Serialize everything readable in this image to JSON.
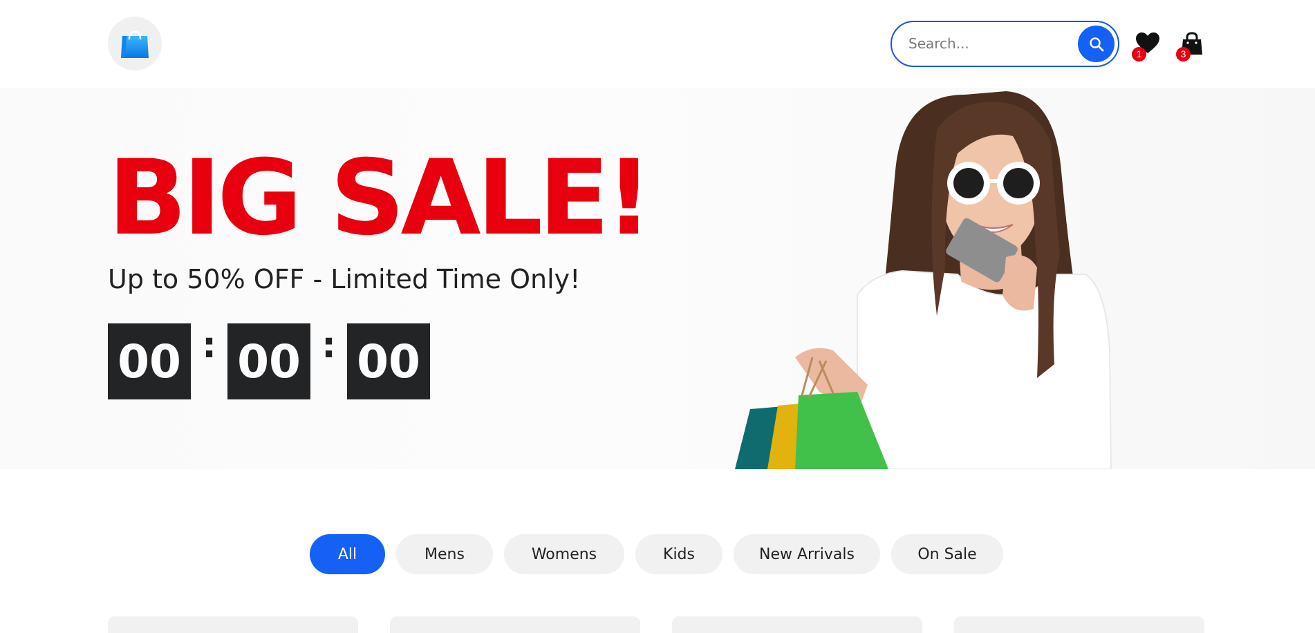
{
  "header": {
    "logo_icon": "shopping-bag-icon",
    "search": {
      "placeholder": "Search...",
      "icon": "search-icon"
    },
    "wishlist": {
      "icon": "heart-icon",
      "count": "1"
    },
    "cart": {
      "icon": "bag-icon",
      "count": "3"
    }
  },
  "hero": {
    "title": "BIG SALE!",
    "subtitle": "Up to 50% OFF - Limited Time Only!",
    "countdown": {
      "hours": "00",
      "minutes": "00",
      "seconds": "00",
      "separator": ":"
    },
    "accent_color": "#e8000f"
  },
  "categories": {
    "items": [
      {
        "label": "All",
        "active": true
      },
      {
        "label": "Mens",
        "active": false
      },
      {
        "label": "Womens",
        "active": false
      },
      {
        "label": "Kids",
        "active": false
      },
      {
        "label": "New Arrivals",
        "active": false
      },
      {
        "label": "On Sale",
        "active": false
      }
    ],
    "active_color": "#1560f5"
  }
}
